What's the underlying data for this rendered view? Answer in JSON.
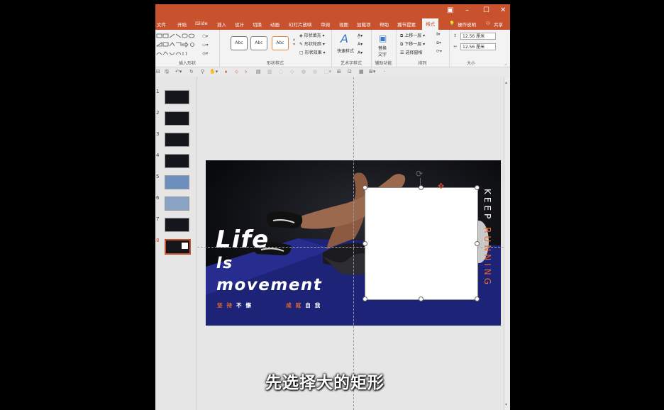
{
  "window": {
    "controls": [
      "▣",
      "–",
      "☐",
      "✕"
    ]
  },
  "tabs": [
    {
      "label": "文件"
    },
    {
      "label": "开始"
    },
    {
      "label": "iSlide"
    },
    {
      "label": "插入"
    },
    {
      "label": "设计"
    },
    {
      "label": "切换"
    },
    {
      "label": "动画"
    },
    {
      "label": "幻灯片放映"
    },
    {
      "label": "审阅"
    },
    {
      "label": "视图"
    },
    {
      "label": "加载项"
    },
    {
      "label": "帮助"
    },
    {
      "label": "播节提要"
    },
    {
      "label": "格式"
    }
  ],
  "tell_me": "操作说明",
  "share": "共享",
  "ribbon": {
    "insert_shapes_label": "插入形状",
    "shape_styles_label": "形状样式",
    "style_sample": "Abc",
    "fill": "形状填充",
    "outline": "形状轮廓",
    "effects": "形状效果",
    "quick_styles": "快速样式",
    "wordart_label": "艺术字样式",
    "alt_text": "替换\n文字",
    "accessibility_label": "辅助功能",
    "bring_forward": "上移一层",
    "send_backward": "下移一层",
    "selection_pane": "选择窗格",
    "arrange_label": "排列",
    "height": "12.56 厘米",
    "width": "12.56 厘米",
    "size_label": "大小"
  },
  "slides": [
    {
      "num": "1"
    },
    {
      "num": "2"
    },
    {
      "num": "3"
    },
    {
      "num": "4"
    },
    {
      "num": "5"
    },
    {
      "num": "6"
    },
    {
      "num": "7"
    },
    {
      "num": "8"
    }
  ],
  "slide_content": {
    "line1": "Life",
    "line2": "Is",
    "line3": "movement",
    "cn_a_orange": "坚持",
    "cn_a_white": "不懈",
    "cn_b_orange": "成就",
    "cn_b_white": "自我",
    "keep": "KEEP",
    "running": "RUNNING"
  },
  "subtitle": "先选择大的矩形",
  "colors": {
    "accent": "#c8522d",
    "slide_orange": "#e8692c"
  }
}
